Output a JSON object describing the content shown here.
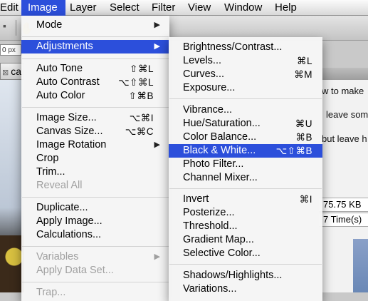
{
  "menubar": {
    "items": [
      "Edit",
      "Image",
      "Layer",
      "Select",
      "Filter",
      "View",
      "Window",
      "Help"
    ],
    "active": "Image"
  },
  "background": {
    "zoom_field": "0 px",
    "doc_tab": "ca",
    "panel_lines": [
      "w to make",
      "leave som",
      "but leave h"
    ],
    "panel_fields": [
      "75.75 KB",
      "7 Time(s)"
    ]
  },
  "image_menu": {
    "mode": "Mode",
    "adjustments": "Adjustments",
    "auto_tone": "Auto Tone",
    "auto_tone_sc": "⇧⌘L",
    "auto_contrast": "Auto Contrast",
    "auto_contrast_sc": "⌥⇧⌘L",
    "auto_color": "Auto Color",
    "auto_color_sc": "⇧⌘B",
    "image_size": "Image Size...",
    "image_size_sc": "⌥⌘I",
    "canvas_size": "Canvas Size...",
    "canvas_size_sc": "⌥⌘C",
    "image_rotation": "Image Rotation",
    "crop": "Crop",
    "trim": "Trim...",
    "reveal_all": "Reveal All",
    "duplicate": "Duplicate...",
    "apply_image": "Apply Image...",
    "calculations": "Calculations...",
    "variables": "Variables",
    "apply_data_set": "Apply Data Set...",
    "trap": "Trap..."
  },
  "adjustments_menu": {
    "brightness_contrast": "Brightness/Contrast...",
    "levels": "Levels...",
    "levels_sc": "⌘L",
    "curves": "Curves...",
    "curves_sc": "⌘M",
    "exposure": "Exposure...",
    "vibrance": "Vibrance...",
    "hue_saturation": "Hue/Saturation...",
    "hue_saturation_sc": "⌘U",
    "color_balance": "Color Balance...",
    "color_balance_sc": "⌘B",
    "black_white": "Black & White...",
    "black_white_sc": "⌥⇧⌘B",
    "photo_filter": "Photo Filter...",
    "channel_mixer": "Channel Mixer...",
    "invert": "Invert",
    "invert_sc": "⌘I",
    "posterize": "Posterize...",
    "threshold": "Threshold...",
    "gradient_map": "Gradient Map...",
    "selective_color": "Selective Color...",
    "shadows_highlights": "Shadows/Highlights...",
    "variations": "Variations..."
  },
  "colors": {
    "highlight": "#2c4fdb",
    "disabled_text": "#a0a0a0"
  }
}
